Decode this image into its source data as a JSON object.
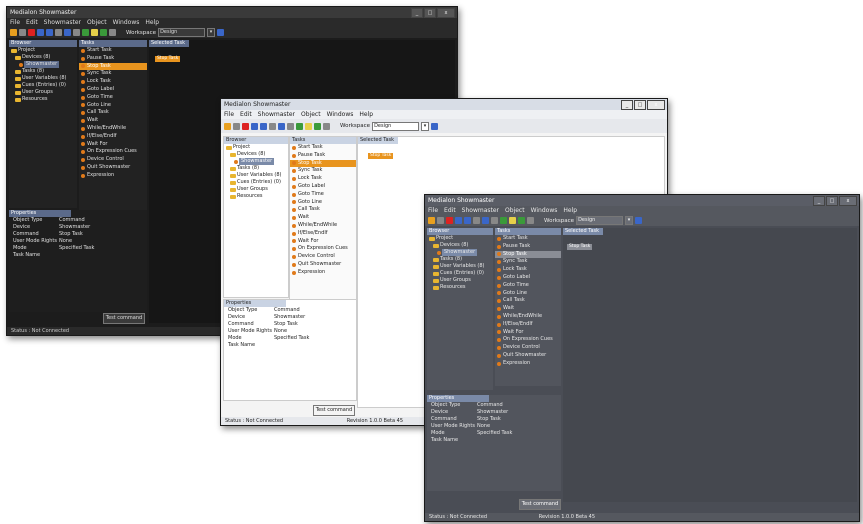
{
  "window_title": "Medialon Showmaster",
  "menu": [
    "File",
    "Edit",
    "Showmaster",
    "Object",
    "Windows",
    "Help"
  ],
  "workspace_label": "Workspace",
  "workspace_value": "Design",
  "headers": {
    "tree": "Browser",
    "commands": "Tasks",
    "canvas": "Selected Task"
  },
  "tree": [
    {
      "label": "Project",
      "level": 0
    },
    {
      "label": "Devices (8)",
      "level": 1
    },
    {
      "label": "Showmaster",
      "level": 2
    },
    {
      "label": "Tasks (8)",
      "level": 1
    },
    {
      "label": "User Variables (8)",
      "level": 1
    },
    {
      "label": "Cues (Entries) (0)",
      "level": 1
    },
    {
      "label": "User Groups",
      "level": 1
    },
    {
      "label": "Resources",
      "level": 1
    }
  ],
  "commands": [
    "Start Task",
    "Pause Task",
    "Stop Task",
    "Sync Task",
    "Lock Task",
    "Goto Label",
    "Goto Time",
    "Goto Line",
    "Call Task",
    "Wait",
    "While/EndWhile",
    "If/Else/EndIf",
    "Wait For",
    "On Expression Cues",
    "Device Control",
    "Quit Showmaster",
    "Expression"
  ],
  "selected_command": "Stop Task",
  "canvas_chip": "Stop Task",
  "properties_header": "Properties",
  "properties": [
    {
      "k": "Object Type",
      "v": "Command"
    },
    {
      "k": "Device",
      "v": "Showmaster"
    },
    {
      "k": "Command",
      "v": "Stop Task"
    },
    {
      "k": "User Mode Rights",
      "v": "None"
    },
    {
      "k": "Mode",
      "v": "Specified Task"
    },
    {
      "k": "Task Name",
      "v": ""
    }
  ],
  "button_label": "Test command",
  "status_left": "Status : Not Connected",
  "status_right": "Revision 1.0.0 Beta 45",
  "win_btns": {
    "min": "_",
    "max": "□",
    "close": "x"
  }
}
